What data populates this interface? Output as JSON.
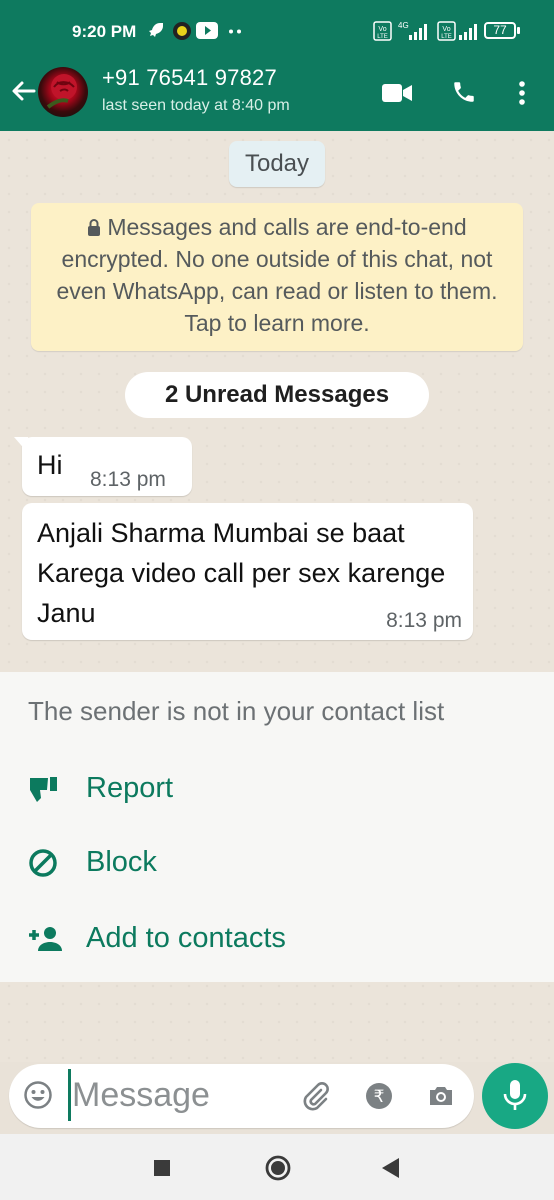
{
  "status_bar": {
    "time": "9:20 PM",
    "battery": "77"
  },
  "chat_header": {
    "contact_name": "+91 76541 97827",
    "last_seen": "last seen today at 8:40 pm"
  },
  "chat": {
    "date_chip": "Today",
    "encryption_notice": "Messages and calls are end-to-end encrypted. No one outside of this chat, not even WhatsApp, can read or listen to them. Tap to learn more.",
    "unread_label": "2 Unread Messages",
    "messages": [
      {
        "text": "Hi",
        "time": "8:13 pm"
      },
      {
        "text": "Anjali Sharma Mumbai se baat Karega video call per sex karenge Janu",
        "time": "8:13 pm"
      }
    ]
  },
  "unknown_sender": {
    "notice": "The sender is not in your contact list",
    "actions": [
      {
        "label": "Report",
        "icon": "thumbs-down-icon"
      },
      {
        "label": "Block",
        "icon": "block-icon"
      },
      {
        "label": "Add to contacts",
        "icon": "add-person-icon"
      }
    ]
  },
  "composer": {
    "placeholder": "Message"
  },
  "colors": {
    "header": "#0e7a5f",
    "accent": "#0c7a5e",
    "mic_button": "#18a884",
    "bubble": "#ffffff",
    "system_note": "#fdf1c6"
  }
}
